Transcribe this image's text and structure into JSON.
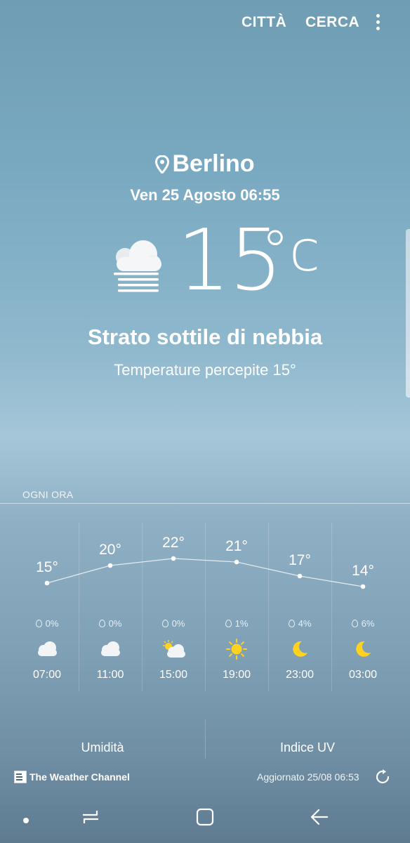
{
  "topbar": {
    "cities_label": "CITTÀ",
    "search_label": "CERCA",
    "more_icon": "more-vertical-icon"
  },
  "location": {
    "city": "Berlino",
    "datetime": "Ven 25 Agosto 06:55",
    "pin_icon": "location-pin-icon"
  },
  "current": {
    "temperature": "15",
    "unit": "°c",
    "condition": "Strato sottile di nebbia",
    "feels_like": "Temperature percepite 15°",
    "icon": "fog-icon"
  },
  "hourly": {
    "label": "OGNI ORA",
    "items": [
      {
        "time": "07:00",
        "temp": "15°",
        "temp_value": 15,
        "precip": "0%",
        "icon": "cloud-icon"
      },
      {
        "time": "11:00",
        "temp": "20°",
        "temp_value": 20,
        "precip": "0%",
        "icon": "cloud-icon"
      },
      {
        "time": "15:00",
        "temp": "22°",
        "temp_value": 22,
        "precip": "0%",
        "icon": "partly-sunny-icon"
      },
      {
        "time": "19:00",
        "temp": "21°",
        "temp_value": 21,
        "precip": "1%",
        "icon": "sun-icon"
      },
      {
        "time": "23:00",
        "temp": "17°",
        "temp_value": 17,
        "precip": "4%",
        "icon": "moon-icon"
      },
      {
        "time": "03:00",
        "temp": "14°",
        "temp_value": 14,
        "precip": "6%",
        "icon": "moon-icon"
      }
    ]
  },
  "details": {
    "humidity_label": "Umidità",
    "uv_label": "Indice UV"
  },
  "footer": {
    "provider": "The Weather Channel",
    "updated": "Aggiornato 25/08 06:53"
  },
  "colors": {
    "sun": "#ffd21f",
    "moon": "#ffd21f",
    "cloud": "#f2f4f6"
  }
}
